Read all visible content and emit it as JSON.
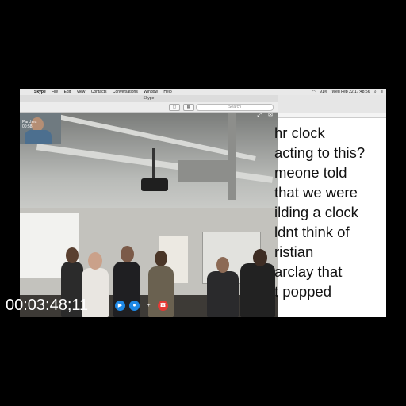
{
  "menubar": {
    "apple_icon": "apple-icon",
    "app_name": "Skype",
    "menus": [
      "File",
      "Edit",
      "View",
      "Contacts",
      "Conversations",
      "Window",
      "Help"
    ],
    "clock": "Wed Feb 22  17:48:56",
    "battery": "91%"
  },
  "skype": {
    "window_title": "Skype",
    "search_placeholder": "Search",
    "caller_name": "Parches",
    "call_duration": "00:58"
  },
  "document": {
    "lines": [
      "hr clock",
      "acting to this?",
      "meone told",
      "that we were",
      "ilding a clock",
      "ldnt think of",
      "ristian",
      "arclay that",
      "t popped"
    ]
  },
  "timecode": "00:03:48;11",
  "colors": {
    "background": "#000000",
    "call_button_blue": "#1e88e5",
    "end_call_red": "#e53935"
  }
}
